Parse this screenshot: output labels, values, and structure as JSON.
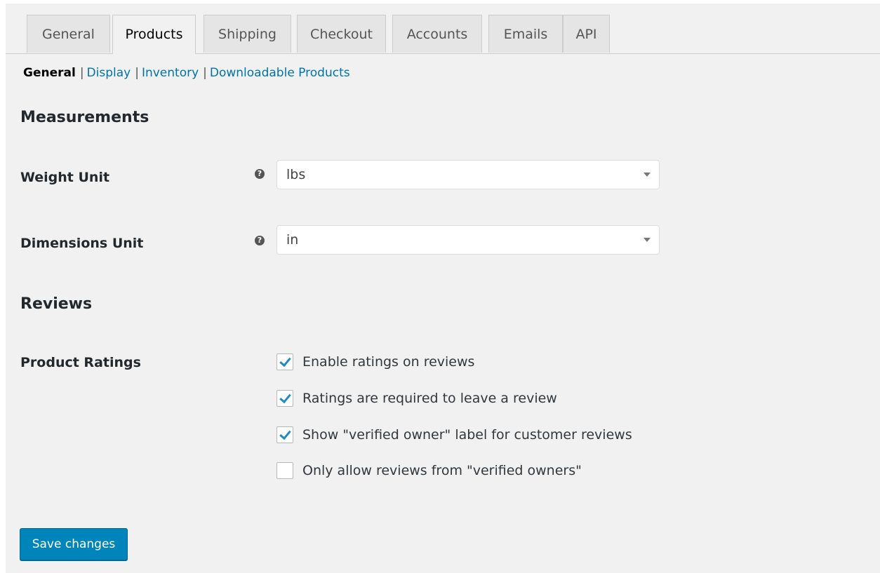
{
  "tabs": [
    {
      "label": "General"
    },
    {
      "label": "Products"
    },
    {
      "label": "Shipping"
    },
    {
      "label": "Checkout"
    },
    {
      "label": "Accounts"
    },
    {
      "label": "Emails"
    },
    {
      "label": "API"
    }
  ],
  "active_tab": "Products",
  "subnav": {
    "current": "General",
    "links": [
      "Display",
      "Inventory",
      "Downloadable Products"
    ],
    "separator": "|"
  },
  "sections": {
    "measurements": "Measurements",
    "reviews": "Reviews"
  },
  "fields": {
    "weight_unit": {
      "label": "Weight Unit",
      "value": "lbs"
    },
    "dimensions_unit": {
      "label": "Dimensions Unit",
      "value": "in"
    },
    "product_ratings": {
      "label": "Product Ratings"
    }
  },
  "help_icon_glyph": "?",
  "checkboxes": [
    {
      "label": "Enable ratings on reviews",
      "checked": true
    },
    {
      "label": "Ratings are required to leave a review",
      "checked": true
    },
    {
      "label": "Show \"verified owner\" label for customer reviews",
      "checked": true
    },
    {
      "label": "Only allow reviews from \"verified owners\"",
      "checked": false
    }
  ],
  "save_label": "Save changes",
  "colors": {
    "accent": "#0085ba",
    "link": "#0073aa",
    "background": "#f1f1f1"
  }
}
